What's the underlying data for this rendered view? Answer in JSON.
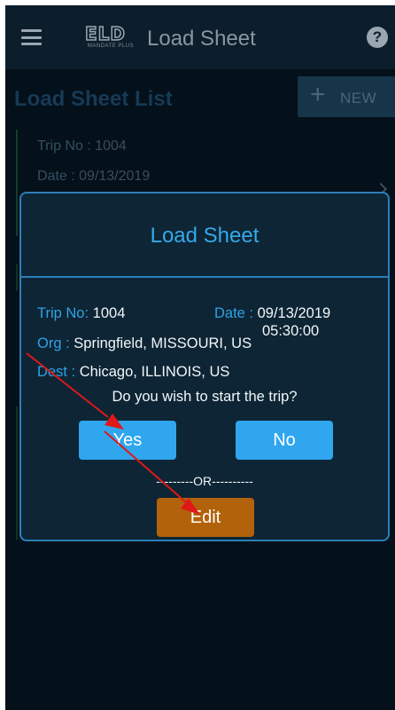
{
  "appbar": {
    "logo_main": "ELD",
    "logo_sub": "MANDATE PLUS",
    "title": "Load Sheet",
    "help_glyph": "?"
  },
  "page": {
    "list_title": "Load Sheet List",
    "new_button_plus": "+",
    "new_button_label": "NEW",
    "card": {
      "trip_label": "Trip No :",
      "trip_value": "1004",
      "date_label": "Date :",
      "date_value": "09/13/2019"
    }
  },
  "dialog": {
    "title": "Load Sheet",
    "trip_label": "Trip No:",
    "trip_value": "1004",
    "date_label": "Date :",
    "date_value": "09/13/2019",
    "time_value": "05:30:00",
    "org_label": "Org :",
    "org_value": "Springfield, MISSOURI, US",
    "dest_label": "Dest :",
    "dest_value": "Chicago, ILLINOIS, US",
    "question": "Do you wish to start the trip?",
    "yes_label": "Yes",
    "no_label": "No",
    "or_separator": "---------OR----------",
    "edit_label": "Edit"
  },
  "colors": {
    "accent": "#2fa6ee",
    "edit_button": "#b2620a",
    "annotation_arrow": "#e01818",
    "background": "#04101a"
  },
  "icons": {
    "menu": "hamburger-icon",
    "help": "help-circle-icon",
    "new": "plus-icon",
    "card": "chevron-right-icon"
  }
}
